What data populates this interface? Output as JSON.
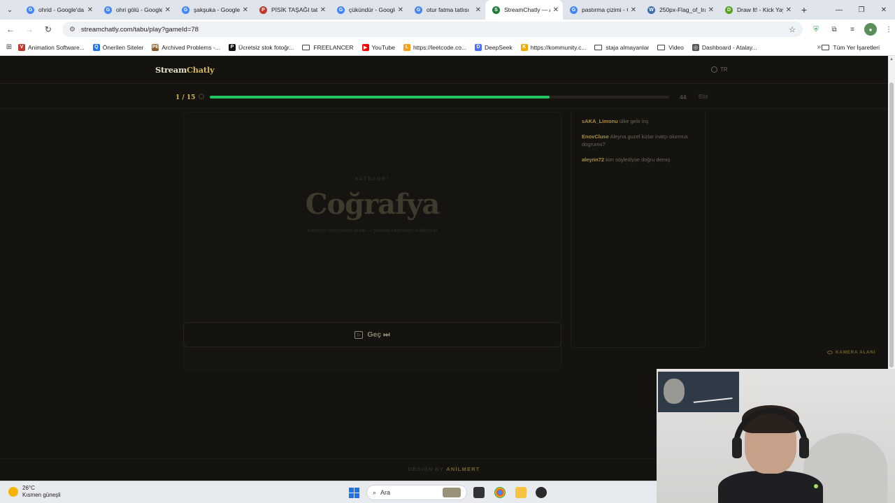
{
  "browser": {
    "tabs": [
      {
        "title": "ohrid - Google'da",
        "color": "#4285f4",
        "glyph": "G"
      },
      {
        "title": "ohri gölü - Google'da",
        "color": "#4285f4",
        "glyph": "G"
      },
      {
        "title": "şakşuka - Google'da",
        "color": "#4285f4",
        "glyph": "G"
      },
      {
        "title": "PİSİK TAŞAĞI tatlısı",
        "color": "#c0392b",
        "glyph": "P"
      },
      {
        "title": "çükündür - Google'da",
        "color": "#4285f4",
        "glyph": "G"
      },
      {
        "title": "otur fatma tatlısı",
        "color": "#4285f4",
        "glyph": "G"
      },
      {
        "title": "StreamChatly — Ana",
        "color": "#1f7a3a",
        "glyph": "S"
      },
      {
        "title": "pastırma çizimi - G",
        "color": "#4285f4",
        "glyph": "G"
      },
      {
        "title": "250px-Flag_of_Iraq",
        "color": "#3a6ea5",
        "glyph": "W"
      },
      {
        "title": "Draw It! - Kick Yayı",
        "color": "#53a318",
        "glyph": "D"
      }
    ],
    "active_tab": 6,
    "url": "streamchatly.com/tabu/play?gameId=78",
    "bookmarks": [
      {
        "label": "Animation Software...",
        "type": "icon",
        "color": "#c0392b",
        "glyph": "V"
      },
      {
        "label": "Önerilen Siteler",
        "type": "icon",
        "color": "#1a73e8",
        "glyph": "Q"
      },
      {
        "label": "Archived Problems -...",
        "type": "icon",
        "color": "#8b5a2b",
        "glyph": "PE"
      },
      {
        "label": "Ücretsiz stok fotoğr...",
        "type": "icon",
        "color": "#111111",
        "glyph": "P"
      },
      {
        "label": "FREELANCER",
        "type": "folder"
      },
      {
        "label": "YouTube",
        "type": "icon",
        "color": "#ff0000",
        "glyph": "▶"
      },
      {
        "label": "https://leetcode.co...",
        "type": "icon",
        "color": "#f89f1b",
        "glyph": "L"
      },
      {
        "label": "DeepSeek",
        "type": "icon",
        "color": "#4d6bfe",
        "glyph": "D"
      },
      {
        "label": "https://kommunity.c...",
        "type": "icon",
        "color": "#f2a900",
        "glyph": "K"
      },
      {
        "label": "staja almayanlar",
        "type": "folder"
      },
      {
        "label": "Video",
        "type": "folder"
      },
      {
        "label": "Dashboard - Atalay...",
        "type": "icon",
        "color": "#555555",
        "glyph": "◎"
      }
    ],
    "all_bookmarks": "Tüm Yer İşaretleri"
  },
  "site": {
    "logo_main": "Stream",
    "logo_accent": "Chatly",
    "lang": "TR",
    "round": "1 / 15",
    "progress_fraction": 0.74,
    "time_left": "44",
    "finish_label": "Bitir",
    "category_label": "KATEGORİ",
    "category_name": "Coğrafya",
    "hint": "Kelimeyi izleyicilere anlat — yasaklı kelimeleri kullanma!",
    "skip_label": "Geç ⏭",
    "chat": [
      {
        "user": "sAKA_Limonu",
        "text": "ülke gelir inş"
      },
      {
        "user": "EnovCluse",
        "text": "Aleyna guzel kizlar inatçı olurmus dogrumu?"
      },
      {
        "user": "aleynn72",
        "text": "kim söylediyse doğru demiş"
      }
    ],
    "camera_label": "KAMERA ALANI",
    "footer_prefix": "DESIGN BY ",
    "footer_name": "ANİLMERT"
  },
  "taskbar": {
    "temp": "26°C",
    "weather": "Kısmen güneşli",
    "search_placeholder": "Ara"
  },
  "colors": {
    "progress": "#22c55e",
    "gold": "#d4b55a"
  }
}
